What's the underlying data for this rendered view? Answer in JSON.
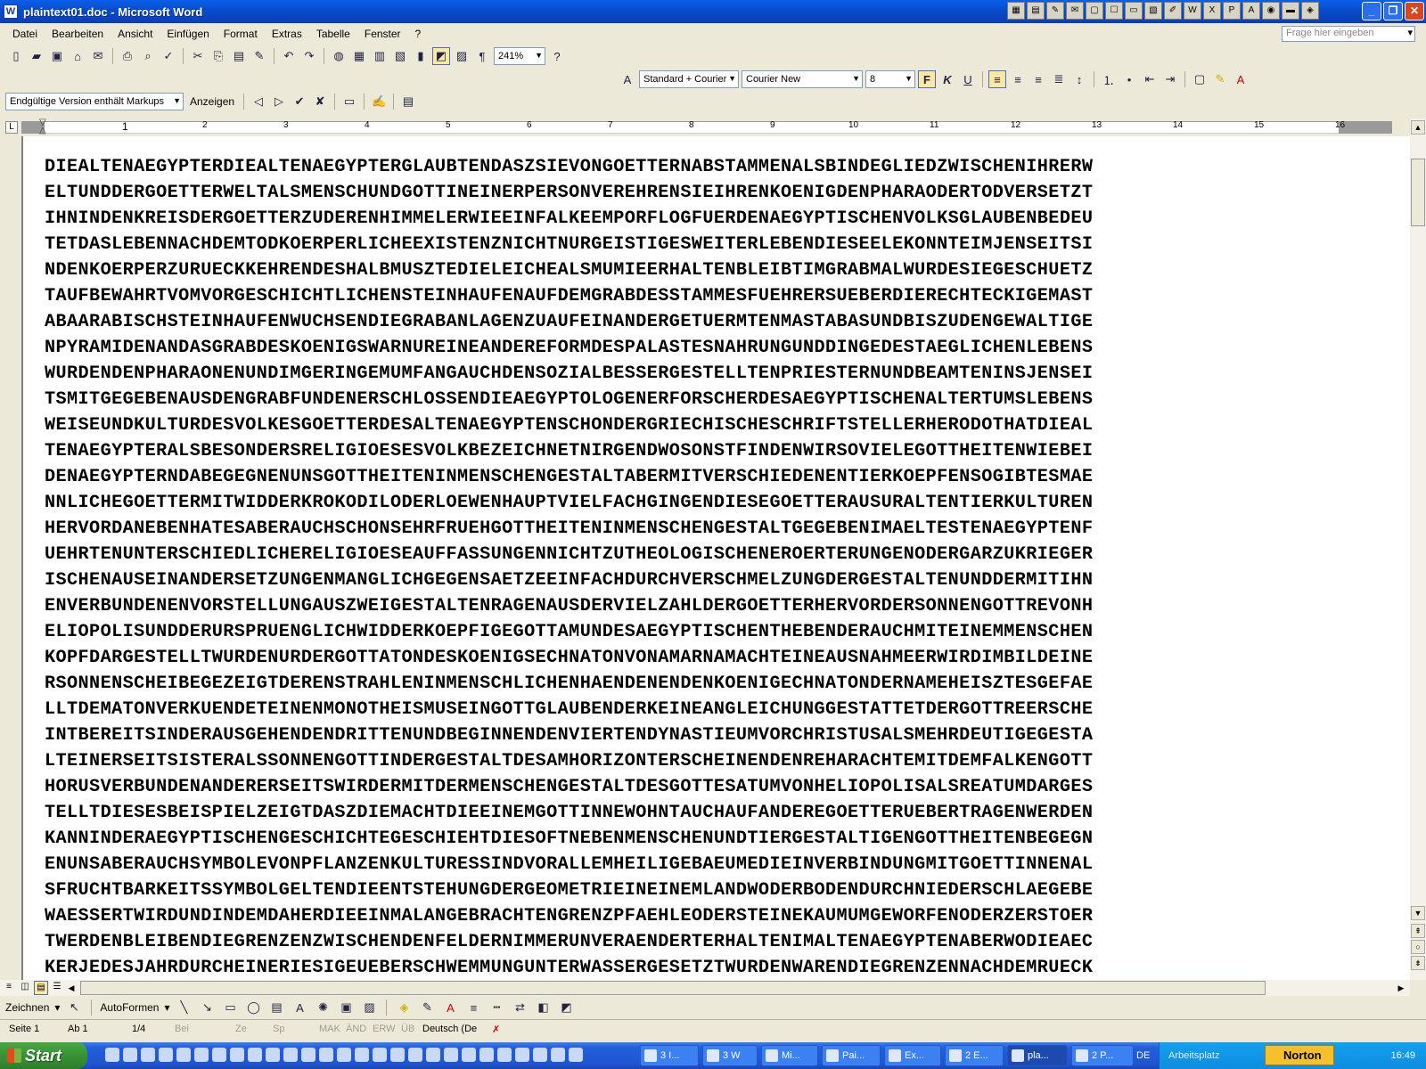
{
  "window": {
    "title": "plaintext01.doc - Microsoft Word",
    "app_icon": "W",
    "controls": [
      "_",
      "❐",
      "✕"
    ]
  },
  "menu": {
    "items": [
      "Datei",
      "Bearbeiten",
      "Ansicht",
      "Einfügen",
      "Format",
      "Extras",
      "Tabelle",
      "Fenster",
      "?"
    ],
    "ask_placeholder": "Frage hier eingeben"
  },
  "standard_toolbar": {
    "zoom": "241%"
  },
  "format_toolbar": {
    "style": "Standard + Courier",
    "font": "Courier New",
    "size": "8",
    "bold": "F",
    "italic": "K",
    "underline": "U"
  },
  "review_toolbar": {
    "markup_mode": "Endgültige Version enthält Markups",
    "show_label": "Anzeigen"
  },
  "ruler": {
    "numbers": [
      "1",
      "2",
      "3",
      "4",
      "5",
      "6",
      "7",
      "8",
      "9",
      "10",
      "11",
      "12",
      "13",
      "14",
      "15",
      "16"
    ]
  },
  "document": {
    "lines": [
      "DIEALTENAEGYPTERDIEALTENAEGYPTERGLAUBTENDASZSIEVONGOETTERNABSTAMMENALSBINDEGLIEDZWISCHENIHRERW",
      "ELTUNDDERGOETTERWELTALSMENSCHUNDGOTTINEINERPERSONVEREHRENSIEIHRENKOENIGDENPHARAODERTODVERSETZT",
      "IHNINDENKREISDERGOETTERZUDERENHIMMELERWIEEINFALKEEMPORFLOGFUERDENAEGYPTISCHENVOLKSGLAUBENBEDEU",
      "TETDASLEBENNACHDEMTODKOERPERLICHEEXISTENZNICHTNURGEISTIGESWEITERLEBENDIESEELEKONNTEIMJENSEITSI",
      "NDENKOERPERZURUECKKEHRENDESHALBMUSZTEDIELEICHEALSMUMIEERHALTENBLEIBTIMGRABMALWURDESIEGESCHUETZ",
      "TAUFBEWAHRTVOMVORGESCHICHTLICHENSTEINHAUFENAUFDEMGRABDESSTAMMESFUEHRERSUEBERDIERECHTECKIGEMAST",
      "ABAARABISCHSTEINHAUFENWUCHSENDIEGRABANLAGENZUAUFEINANDERGETUERMTENMASTABASUNDBISZUDENGEWALTIGE",
      "NPYRAMIDENANDASGRABDESKOENIGSWARNUREINEANDEREFORMDESPALASTESNAHRUNGUNDDINGEDESTAEGLICHENLEBENS",
      "WURDENDENPHARAONENUNDIMGERINGEMUMFANGAUCHDENSOZIALBESSERGESTELLTENPRIESTERNUNDBEAMTENINSJENSEI",
      "TSMITGEGEBENAUSDENGRABFUNDENERSCHLOSSENDIEAEGYPTOLOGENERFORSCHERDESAEGYPTISCHENALTERTUMSLEBENS",
      "WEISEUNDKULTURDESVOLKESGOETTERDESALTENAEGYPTENSCHONDERGRIECHISCHESCHRIFTSTELLERHERODOTHATDIEAL",
      "TENAEGYPTERALSBESONDERSRELIGIOESESVOLKBEZEICHNETNIRGENDWOSONSTFINDENWIRSOVIELEGOTTHEITENWIEBEI",
      "DENAEGYPTERNDABEGEGNENUNSGOTTHEITENINMENSCHENGESTALTABERMITVERSCHIEDENENTIERKOEPFENSOGIBTESMAE",
      "NNLICHEGOETTERMITWIDDERKROKODILODERLOEWENHAUPTVIELFACHGINGENDIESEGOETTERAUSURALTENTIERKULTUREN",
      "HERVORDANEBENHATESABERAUCHSCHONSEHRFRUEHGOTTHEITENINMENSCHENGESTALTGEGEBENIMAELTESTENAEGYPTENF",
      "UEHRTENUNTERSCHIEDLICHERELIGIOESEAUFFASSUNGENNICHTZUTHEOLOGISCHENEROERTERUNGENODERGARZUKRIEGER",
      "ISCHENAUSEINANDERSETZUNGENMANGLICHGEGENSAETZEEINFACHDURCHVERSCHMELZUNGDERGESTALTENUNDDERMITIHN",
      "ENVERBUNDENENVORSTELLUNGAUSZWEIGESTALTENRAGENAUSDERVIELZAHLDERGOETTERHERVORDERSONNENGOTTREVONH",
      "ELIOPOLISUNDDERURSPRUENGLICHWIDDERKOEPFIGEGOTTAMUNDESAEGYPTISCHENTHEBENDERAUCHMITEINEMMENSCHEN",
      "KOPFDARGESTELLTWURDENURDERGOTTATONDESKOENIGSECHNATONVONAMARNAMACHTEINEAUSNAHMEERWIRDIMBILDEINE",
      "RSONNENSCHEIBEGEZEIGTDERENSTRAHLENINMENSCHLICHENHAENDENENDENKOENIGECHNATONDERNAMEHEISZTESGEFAE",
      "LLTDEMATONVERKUENDETEINENMONOTHEISMUSEINGOTTGLAUBENDERKEINEANGLEICHUNGGESTATTETDERGOTTREERSCHE",
      "INTBEREITSINDERAUSGEHENDENDRITTENUNDBEGINNENDENVIERTENDYNASTIEUMVORCHRISTUSALSMEHRDEUTIGEGESTA",
      "LTEINERSEITSISTERALSSONNENGOTTINDERGESTALTDESAMHORIZONTERSCHEINENDENREHARACHTEMITDEMFALKENGOTT",
      "HORUSVERBUNDENANDERERSEITSWIRDERMITDERMENSCHENGESTALTDESGOTTESATUMVONHELIOPOLISALSREATUMDARGES",
      "TELLTDIESESBEISPIELZEIGTDASZDIEMACHTDIEEINEMGOTTINNEWOHNTAUCHAUFANDEREGOETTERUEBERTRAGENWERDEN",
      "KANNINDERAEGYPTISCHENGESCHICHTEGESCHIEHTDIESOFTNEBENMENSCHENUNDTIERGESTALTIGENGOTTHEITENBEGEGN",
      "ENUNSABERAUCHSYMBOLEVONPFLANZENKULTURESSINDVORALLEMHEILIGEBAEUMEDIEINVERBINDUNGMITGOETTINNENAL",
      "SFRUCHTBARKEITSSYMBOLGELTENDIEENTSTEHUNGDERGEOMETRIEINEINEMLANDWODERBODENDURCHNIEDERSCHLAEGEBE",
      "WAESSERTWIRDUNDINDEMDAHERDIEEINMALANGEBRACHTENGRENZPFAEHLEODERSTEINEKAUMUMGEWORFENODERZERSTOER",
      "TWERDENBLEIBENDIEGRENZENZWISCHENDENFELDERNIMMERUNVERAENDERTERHALTENIMALTENAEGYPTENABERWODIEAEC",
      "KERJEDESJAHRDURCHEINERIESIGEUEBERSCHWEMMUNGUNTERWASSERGESETZTWURDENWARENDIEGRENZENNACHDEMRUECK"
    ]
  },
  "drawing_toolbar": {
    "draw_label": "Zeichnen",
    "autoshapes_label": "AutoFormen"
  },
  "statusbar": {
    "page": "Seite  1",
    "section": "Ab  1",
    "page_of": "1/4",
    "at": "Bei",
    "line": "Ze",
    "col": "Sp",
    "mak": "MAK",
    "and": "ÄND",
    "erw": "ERW",
    "ub": "ÜB",
    "language": "Deutsch (De"
  },
  "taskbar": {
    "start": "Start",
    "buttons": [
      {
        "label": "3 I...",
        "active": false
      },
      {
        "label": "3 W",
        "active": false
      },
      {
        "label": "Mi...",
        "active": false
      },
      {
        "label": "Pai...",
        "active": false
      },
      {
        "label": "Ex...",
        "active": false
      },
      {
        "label": "2 E...",
        "active": false
      },
      {
        "label": "pla...",
        "active": true
      },
      {
        "label": "2 P...",
        "active": false
      }
    ],
    "lang": "DE",
    "workspace": "Arbeitsplatz",
    "norton": "Norton",
    "clock": "16:49"
  }
}
